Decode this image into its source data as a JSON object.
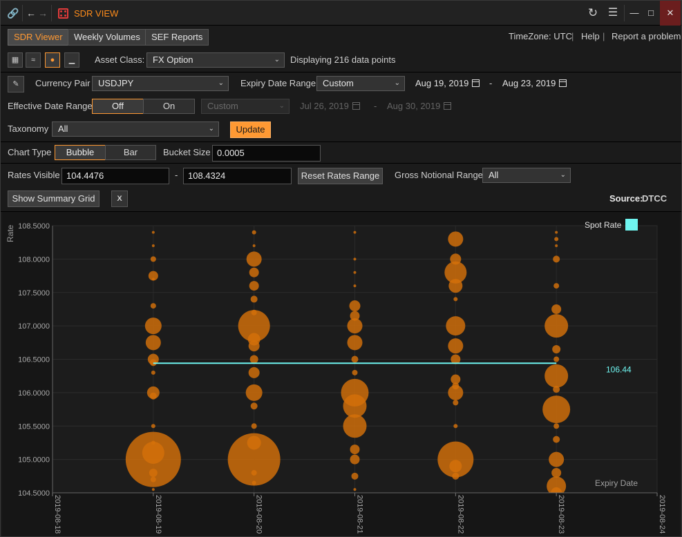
{
  "window": {
    "title": "SDR VIEW",
    "controls": [
      "refresh",
      "menu",
      "minimize",
      "maximize",
      "close"
    ]
  },
  "tabs": [
    {
      "label": "SDR Viewer",
      "active": true
    },
    {
      "label": "Weekly Volumes",
      "active": false
    },
    {
      "label": "SEF Reports",
      "active": false
    }
  ],
  "header_links": {
    "timezone": "TimeZone: UTC",
    "sep": "|",
    "help": "Help",
    "report": "Report a problem"
  },
  "asset": {
    "label": "Asset Class:",
    "value": "FX Option",
    "status": "Displaying 216 data points"
  },
  "filters": {
    "currency_label": "Currency Pair",
    "currency_value": "USDJPY",
    "expiry_label": "Expiry Date Range",
    "expiry_value": "Custom",
    "expiry_from": "Aug 19, 2019",
    "expiry_to": "Aug 23, 2019",
    "dash": "-",
    "effective_label": "Effective Date Range",
    "effective_off": "Off",
    "effective_on": "On",
    "effective_value": "Custom",
    "effective_from": "Jul 26, 2019",
    "effective_to": "Aug 30, 2019",
    "taxonomy_label": "Taxonomy",
    "taxonomy_value": "All",
    "update_label": "Update"
  },
  "chart_controls": {
    "type_label": "Chart Type",
    "bubble": "Bubble",
    "bar": "Bar",
    "bucket_label": "Bucket Size",
    "bucket_value": "0.0005",
    "rates_label": "Rates Visible",
    "rates_min": "104.4476",
    "rates_max": "108.4324",
    "reset_label": "Reset Rates Range",
    "notional_label": "Gross Notional Range",
    "notional_value": "All",
    "summary_label": "Show Summary Grid",
    "source_label": "Source:",
    "source_value": "DTCC"
  },
  "colors": {
    "accent": "#ff9933",
    "bubble": "#d4700a",
    "spot": "#6ff5f0",
    "link": "#39a0e6"
  },
  "chart_data": {
    "type": "scatter",
    "ylabel": "Rate",
    "xlabel": "Expiry Date",
    "ylim": [
      104.5,
      108.5
    ],
    "y_ticks": [
      "108.5000",
      "108.0000",
      "107.5000",
      "107.0000",
      "106.5000",
      "106.0000",
      "105.5000",
      "105.0000",
      "104.5000"
    ],
    "x_ticks": [
      "2019-08-18",
      "2019-08-19",
      "2019-08-20",
      "2019-08-21",
      "2019-08-22",
      "2019-08-23",
      "2019-08-24"
    ],
    "legend": {
      "label": "Spot Rate",
      "placement": "top-right"
    },
    "spot": {
      "from": "2019-08-19",
      "to": "2019-08-23",
      "rate": 106.44,
      "label": "106.44"
    },
    "grid": true,
    "bubbles": [
      {
        "date": "2019-08-19",
        "points": [
          [
            108.4,
            2
          ],
          [
            108.2,
            2
          ],
          [
            108.0,
            4
          ],
          [
            107.75,
            7
          ],
          [
            107.7,
            2
          ],
          [
            107.3,
            4
          ],
          [
            107.0,
            12
          ],
          [
            106.75,
            11
          ],
          [
            106.5,
            8
          ],
          [
            106.45,
            5
          ],
          [
            106.3,
            3
          ],
          [
            106.0,
            9
          ],
          [
            105.95,
            5
          ],
          [
            105.5,
            3
          ],
          [
            105.25,
            3
          ],
          [
            105.1,
            16
          ],
          [
            105.0,
            40
          ],
          [
            104.8,
            6
          ],
          [
            104.7,
            4
          ],
          [
            104.55,
            2
          ]
        ]
      },
      {
        "date": "2019-08-20",
        "points": [
          [
            108.4,
            3
          ],
          [
            108.2,
            2
          ],
          [
            108.0,
            11
          ],
          [
            107.8,
            7
          ],
          [
            107.6,
            7
          ],
          [
            107.4,
            5
          ],
          [
            107.2,
            4
          ],
          [
            107.0,
            23
          ],
          [
            106.8,
            9
          ],
          [
            106.7,
            8
          ],
          [
            106.5,
            6
          ],
          [
            106.3,
            8
          ],
          [
            106.0,
            12
          ],
          [
            105.8,
            5
          ],
          [
            105.5,
            4
          ],
          [
            105.25,
            10
          ],
          [
            105.0,
            38
          ],
          [
            104.8,
            4
          ],
          [
            104.65,
            3
          ]
        ]
      },
      {
        "date": "2019-08-21",
        "points": [
          [
            108.4,
            2
          ],
          [
            108.0,
            2
          ],
          [
            107.8,
            2
          ],
          [
            107.6,
            2
          ],
          [
            107.3,
            8
          ],
          [
            107.15,
            7
          ],
          [
            107.0,
            11
          ],
          [
            106.75,
            11
          ],
          [
            106.5,
            5
          ],
          [
            106.3,
            4
          ],
          [
            106.0,
            20
          ],
          [
            105.8,
            17
          ],
          [
            105.5,
            17
          ],
          [
            105.15,
            7
          ],
          [
            105.0,
            7
          ],
          [
            104.75,
            5
          ],
          [
            104.55,
            2
          ]
        ]
      },
      {
        "date": "2019-08-22",
        "points": [
          [
            108.3,
            11
          ],
          [
            108.0,
            8
          ],
          [
            107.8,
            16
          ],
          [
            107.6,
            10
          ],
          [
            107.4,
            3
          ],
          [
            107.0,
            14
          ],
          [
            106.7,
            11
          ],
          [
            106.5,
            7
          ],
          [
            106.2,
            7
          ],
          [
            106.1,
            5
          ],
          [
            106.0,
            11
          ],
          [
            105.85,
            4
          ],
          [
            105.5,
            3
          ],
          [
            105.0,
            26
          ],
          [
            104.9,
            9
          ],
          [
            104.75,
            5
          ]
        ]
      },
      {
        "date": "2019-08-23",
        "points": [
          [
            108.4,
            2
          ],
          [
            108.3,
            3
          ],
          [
            108.2,
            2
          ],
          [
            108.0,
            5
          ],
          [
            107.6,
            4
          ],
          [
            107.25,
            7
          ],
          [
            107.0,
            17
          ],
          [
            106.65,
            6
          ],
          [
            106.5,
            4
          ],
          [
            106.25,
            17
          ],
          [
            106.05,
            5
          ],
          [
            105.75,
            20
          ],
          [
            105.5,
            4
          ],
          [
            105.3,
            5
          ],
          [
            105.0,
            11
          ],
          [
            104.8,
            7
          ],
          [
            104.6,
            14
          ],
          [
            104.5,
            8
          ]
        ]
      }
    ]
  }
}
